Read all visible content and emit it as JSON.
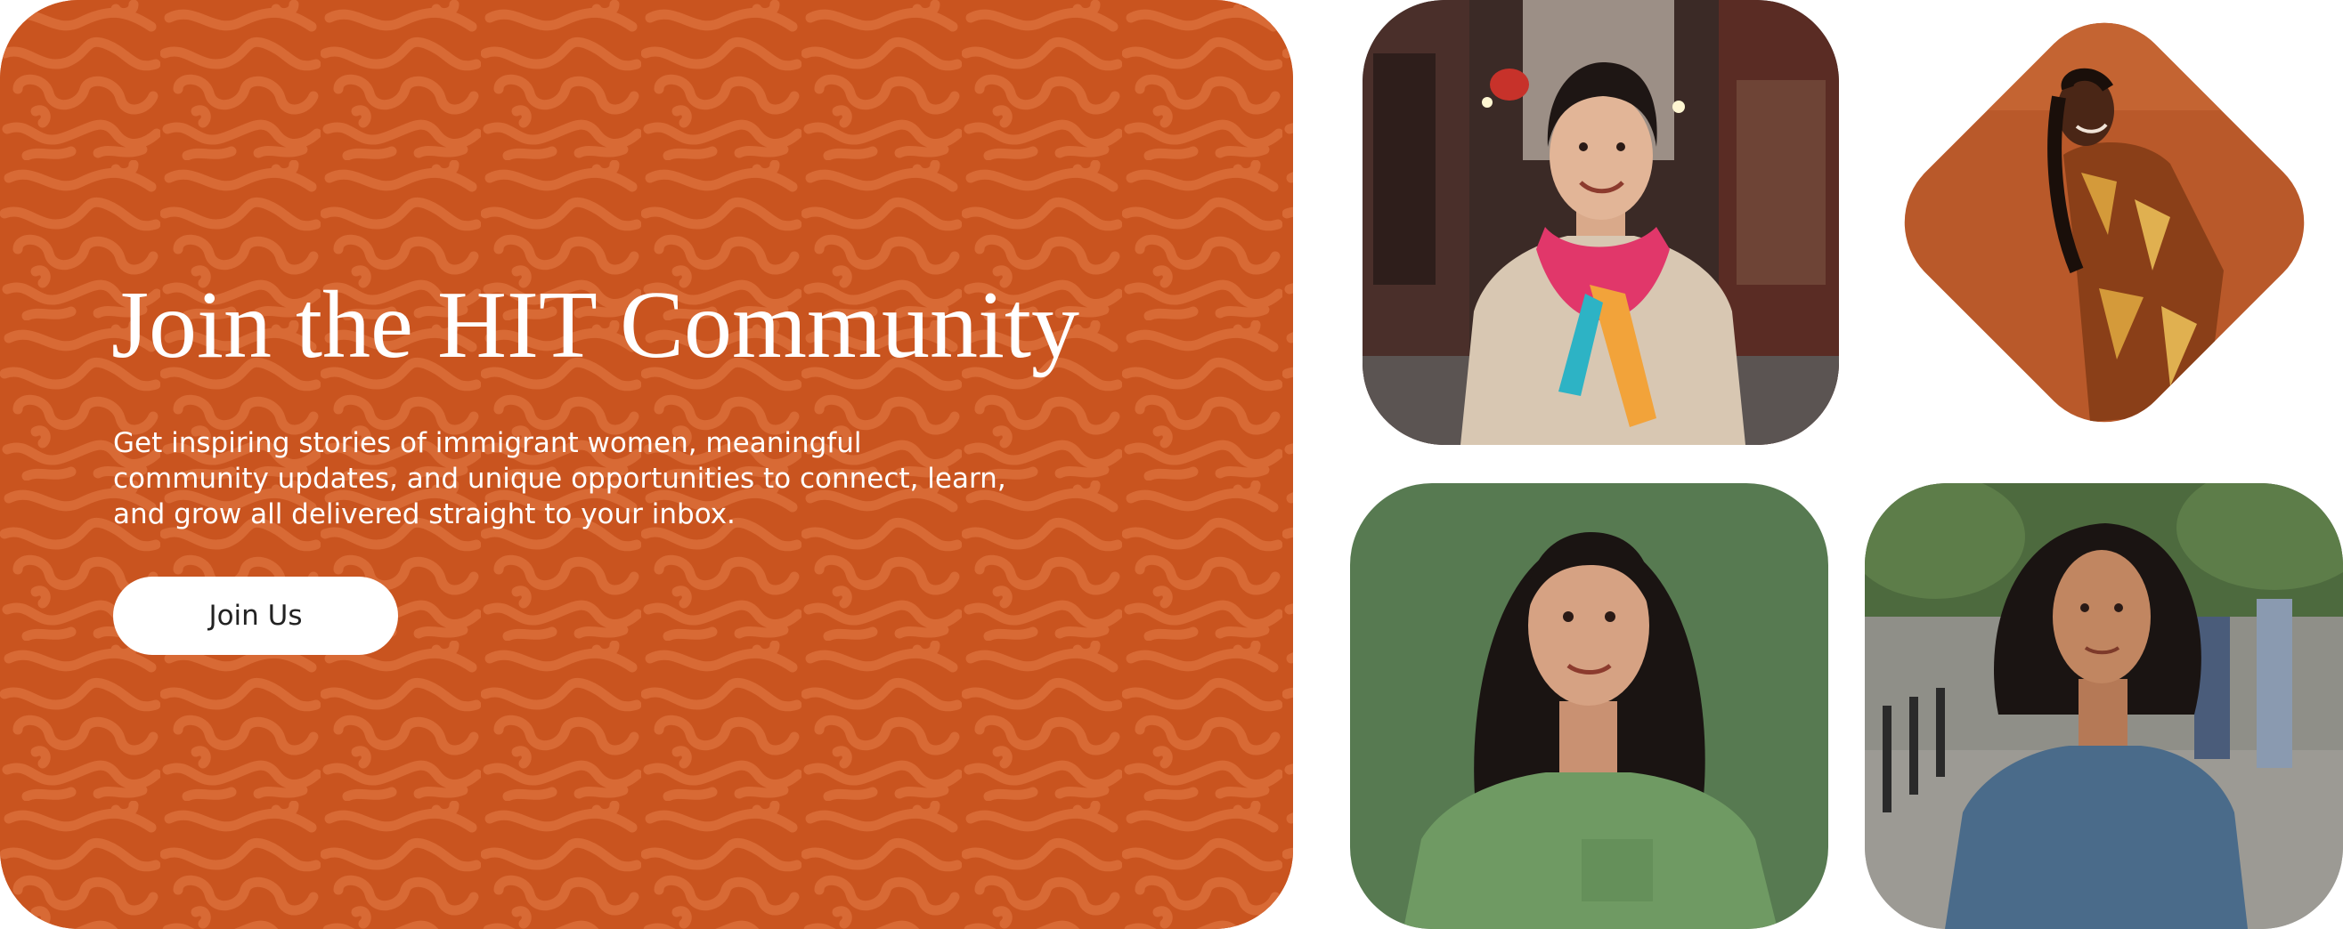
{
  "cta": {
    "title": "Join the HIT Community",
    "description": "Get inspiring stories of immigrant women, meaningful community updates, and unique opportunities to connect, learn, and grow  all delivered straight to your inbox.",
    "button_label": "Join Us"
  },
  "colors": {
    "panel_orange": "#c9541f",
    "pattern_orange": "#d86a35",
    "button_bg": "#ffffff",
    "text_light": "#ffffff",
    "button_text": "#222222"
  },
  "photos": [
    {
      "name": "woman-in-chinatown-alley-photo",
      "background": "street alley with red lanterns"
    },
    {
      "name": "woman-in-green-shirt-photo",
      "background": "solid green studio backdrop"
    },
    {
      "name": "woman-in-blue-tunic-photo",
      "background": "busy city street"
    },
    {
      "name": "woman-in-patterned-dress-photo",
      "background": "solid orange backdrop"
    }
  ]
}
